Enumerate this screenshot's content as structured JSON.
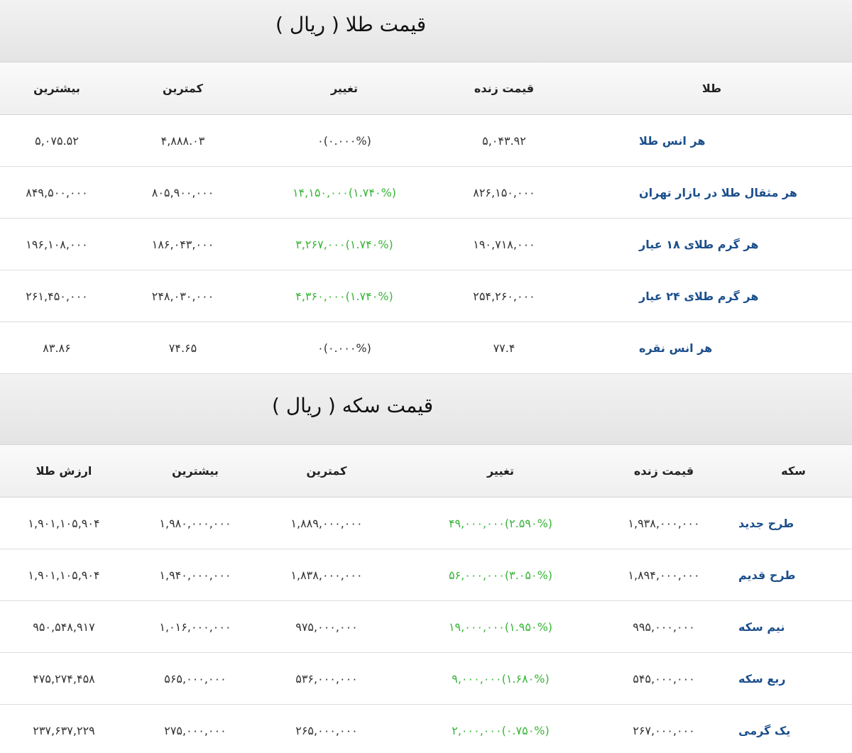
{
  "gold": {
    "title": "قیمت طلا ( ریال )",
    "headers": {
      "name": "طلا",
      "live": "قیمت زنده",
      "change": "تغییر",
      "min": "کمترین",
      "max": "بیشترین"
    },
    "rows": [
      {
        "name": "هر انس طلا",
        "live": "۵,۰۴۳.۹۲",
        "change_amount": "۰",
        "change_pct": "(۰.۰۰۰%)",
        "change_color": "#333333",
        "min": "۴,۸۸۸.۰۳",
        "max": "۵,۰۷۵.۵۲"
      },
      {
        "name": "هر مثقال طلا در بازار تهران",
        "live": "۸۲۶,۱۵۰,۰۰۰",
        "change_amount": "۱۴,۱۵۰,۰۰۰",
        "change_pct": "(۱.۷۴۰%)",
        "change_color": "#3ab53a",
        "min": "۸۰۵,۹۰۰,۰۰۰",
        "max": "۸۴۹,۵۰۰,۰۰۰"
      },
      {
        "name": "هر گرم طلای ۱۸ عیار",
        "live": "۱۹۰,۷۱۸,۰۰۰",
        "change_amount": "۳,۲۶۷,۰۰۰",
        "change_pct": "(۱.۷۴۰%)",
        "change_color": "#3ab53a",
        "min": "۱۸۶,۰۴۳,۰۰۰",
        "max": "۱۹۶,۱۰۸,۰۰۰"
      },
      {
        "name": "هر گرم طلای ۲۴ عیار",
        "live": "۲۵۴,۲۶۰,۰۰۰",
        "change_amount": "۴,۳۶۰,۰۰۰",
        "change_pct": "(۱.۷۴۰%)",
        "change_color": "#3ab53a",
        "min": "۲۴۸,۰۳۰,۰۰۰",
        "max": "۲۶۱,۴۵۰,۰۰۰"
      },
      {
        "name": "هر انس نقره",
        "live": "۷۷.۴",
        "change_amount": "۰",
        "change_pct": "(۰.۰۰۰%)",
        "change_color": "#333333",
        "min": "۷۴.۶۵",
        "max": "۸۳.۸۶"
      }
    ]
  },
  "coin": {
    "title": "قیمت سکه ( ریال )",
    "headers": {
      "name": "سکه",
      "live": "قیمت زنده",
      "change": "تغییر",
      "min": "کمترین",
      "max": "بیشترین",
      "gold_value": "ارزش طلا"
    },
    "rows": [
      {
        "name": "طرح جدید",
        "live": "۱,۹۳۸,۰۰۰,۰۰۰",
        "change_amount": "۴۹,۰۰۰,۰۰۰",
        "change_pct": "(۲.۵۹۰%)",
        "change_color": "#3ab53a",
        "min": "۱,۸۸۹,۰۰۰,۰۰۰",
        "max": "۱,۹۸۰,۰۰۰,۰۰۰",
        "gold_value": "۱,۹۰۱,۱۰۵,۹۰۴"
      },
      {
        "name": "طرح قدیم",
        "live": "۱,۸۹۴,۰۰۰,۰۰۰",
        "change_amount": "۵۶,۰۰۰,۰۰۰",
        "change_pct": "(۳.۰۵۰%)",
        "change_color": "#3ab53a",
        "min": "۱,۸۳۸,۰۰۰,۰۰۰",
        "max": "۱,۹۴۰,۰۰۰,۰۰۰",
        "gold_value": "۱,۹۰۱,۱۰۵,۹۰۴"
      },
      {
        "name": "نیم سکه",
        "live": "۹۹۵,۰۰۰,۰۰۰",
        "change_amount": "۱۹,۰۰۰,۰۰۰",
        "change_pct": "(۱.۹۵۰%)",
        "change_color": "#3ab53a",
        "min": "۹۷۵,۰۰۰,۰۰۰",
        "max": "۱,۰۱۶,۰۰۰,۰۰۰",
        "gold_value": "۹۵۰,۵۴۸,۹۱۷"
      },
      {
        "name": "ربع سکه",
        "live": "۵۴۵,۰۰۰,۰۰۰",
        "change_amount": "۹,۰۰۰,۰۰۰",
        "change_pct": "(۱.۶۸۰%)",
        "change_color": "#3ab53a",
        "min": "۵۳۶,۰۰۰,۰۰۰",
        "max": "۵۶۵,۰۰۰,۰۰۰",
        "gold_value": "۴۷۵,۲۷۴,۴۵۸"
      },
      {
        "name": "یک گرمی",
        "live": "۲۶۷,۰۰۰,۰۰۰",
        "change_amount": "۲,۰۰۰,۰۰۰",
        "change_pct": "(۰.۷۵۰%)",
        "change_color": "#3ab53a",
        "min": "۲۶۵,۰۰۰,۰۰۰",
        "max": "۲۷۵,۰۰۰,۰۰۰",
        "gold_value": "۲۳۷,۶۳۷,۲۲۹"
      }
    ]
  }
}
